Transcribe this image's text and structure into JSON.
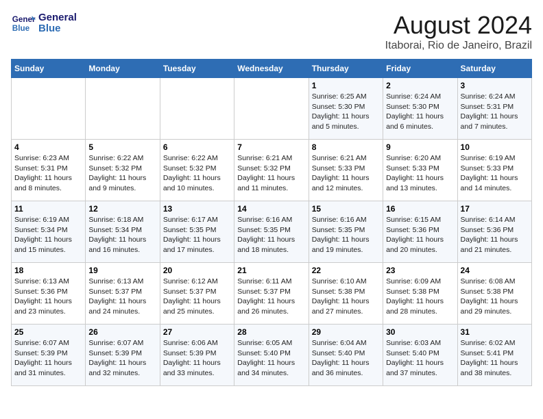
{
  "logo": {
    "line1": "General",
    "line2": "Blue"
  },
  "title": "August 2024",
  "subtitle": "Itaborai, Rio de Janeiro, Brazil",
  "days_of_week": [
    "Sunday",
    "Monday",
    "Tuesday",
    "Wednesday",
    "Thursday",
    "Friday",
    "Saturday"
  ],
  "weeks": [
    [
      {
        "day": "",
        "info": ""
      },
      {
        "day": "",
        "info": ""
      },
      {
        "day": "",
        "info": ""
      },
      {
        "day": "",
        "info": ""
      },
      {
        "day": "1",
        "info": "Sunrise: 6:25 AM\nSunset: 5:30 PM\nDaylight: 11 hours and 5 minutes."
      },
      {
        "day": "2",
        "info": "Sunrise: 6:24 AM\nSunset: 5:30 PM\nDaylight: 11 hours and 6 minutes."
      },
      {
        "day": "3",
        "info": "Sunrise: 6:24 AM\nSunset: 5:31 PM\nDaylight: 11 hours and 7 minutes."
      }
    ],
    [
      {
        "day": "4",
        "info": "Sunrise: 6:23 AM\nSunset: 5:31 PM\nDaylight: 11 hours and 8 minutes."
      },
      {
        "day": "5",
        "info": "Sunrise: 6:22 AM\nSunset: 5:32 PM\nDaylight: 11 hours and 9 minutes."
      },
      {
        "day": "6",
        "info": "Sunrise: 6:22 AM\nSunset: 5:32 PM\nDaylight: 11 hours and 10 minutes."
      },
      {
        "day": "7",
        "info": "Sunrise: 6:21 AM\nSunset: 5:32 PM\nDaylight: 11 hours and 11 minutes."
      },
      {
        "day": "8",
        "info": "Sunrise: 6:21 AM\nSunset: 5:33 PM\nDaylight: 11 hours and 12 minutes."
      },
      {
        "day": "9",
        "info": "Sunrise: 6:20 AM\nSunset: 5:33 PM\nDaylight: 11 hours and 13 minutes."
      },
      {
        "day": "10",
        "info": "Sunrise: 6:19 AM\nSunset: 5:33 PM\nDaylight: 11 hours and 14 minutes."
      }
    ],
    [
      {
        "day": "11",
        "info": "Sunrise: 6:19 AM\nSunset: 5:34 PM\nDaylight: 11 hours and 15 minutes."
      },
      {
        "day": "12",
        "info": "Sunrise: 6:18 AM\nSunset: 5:34 PM\nDaylight: 11 hours and 16 minutes."
      },
      {
        "day": "13",
        "info": "Sunrise: 6:17 AM\nSunset: 5:35 PM\nDaylight: 11 hours and 17 minutes."
      },
      {
        "day": "14",
        "info": "Sunrise: 6:16 AM\nSunset: 5:35 PM\nDaylight: 11 hours and 18 minutes."
      },
      {
        "day": "15",
        "info": "Sunrise: 6:16 AM\nSunset: 5:35 PM\nDaylight: 11 hours and 19 minutes."
      },
      {
        "day": "16",
        "info": "Sunrise: 6:15 AM\nSunset: 5:36 PM\nDaylight: 11 hours and 20 minutes."
      },
      {
        "day": "17",
        "info": "Sunrise: 6:14 AM\nSunset: 5:36 PM\nDaylight: 11 hours and 21 minutes."
      }
    ],
    [
      {
        "day": "18",
        "info": "Sunrise: 6:13 AM\nSunset: 5:36 PM\nDaylight: 11 hours and 23 minutes."
      },
      {
        "day": "19",
        "info": "Sunrise: 6:13 AM\nSunset: 5:37 PM\nDaylight: 11 hours and 24 minutes."
      },
      {
        "day": "20",
        "info": "Sunrise: 6:12 AM\nSunset: 5:37 PM\nDaylight: 11 hours and 25 minutes."
      },
      {
        "day": "21",
        "info": "Sunrise: 6:11 AM\nSunset: 5:37 PM\nDaylight: 11 hours and 26 minutes."
      },
      {
        "day": "22",
        "info": "Sunrise: 6:10 AM\nSunset: 5:38 PM\nDaylight: 11 hours and 27 minutes."
      },
      {
        "day": "23",
        "info": "Sunrise: 6:09 AM\nSunset: 5:38 PM\nDaylight: 11 hours and 28 minutes."
      },
      {
        "day": "24",
        "info": "Sunrise: 6:08 AM\nSunset: 5:38 PM\nDaylight: 11 hours and 29 minutes."
      }
    ],
    [
      {
        "day": "25",
        "info": "Sunrise: 6:07 AM\nSunset: 5:39 PM\nDaylight: 11 hours and 31 minutes."
      },
      {
        "day": "26",
        "info": "Sunrise: 6:07 AM\nSunset: 5:39 PM\nDaylight: 11 hours and 32 minutes."
      },
      {
        "day": "27",
        "info": "Sunrise: 6:06 AM\nSunset: 5:39 PM\nDaylight: 11 hours and 33 minutes."
      },
      {
        "day": "28",
        "info": "Sunrise: 6:05 AM\nSunset: 5:40 PM\nDaylight: 11 hours and 34 minutes."
      },
      {
        "day": "29",
        "info": "Sunrise: 6:04 AM\nSunset: 5:40 PM\nDaylight: 11 hours and 36 minutes."
      },
      {
        "day": "30",
        "info": "Sunrise: 6:03 AM\nSunset: 5:40 PM\nDaylight: 11 hours and 37 minutes."
      },
      {
        "day": "31",
        "info": "Sunrise: 6:02 AM\nSunset: 5:41 PM\nDaylight: 11 hours and 38 minutes."
      }
    ]
  ]
}
